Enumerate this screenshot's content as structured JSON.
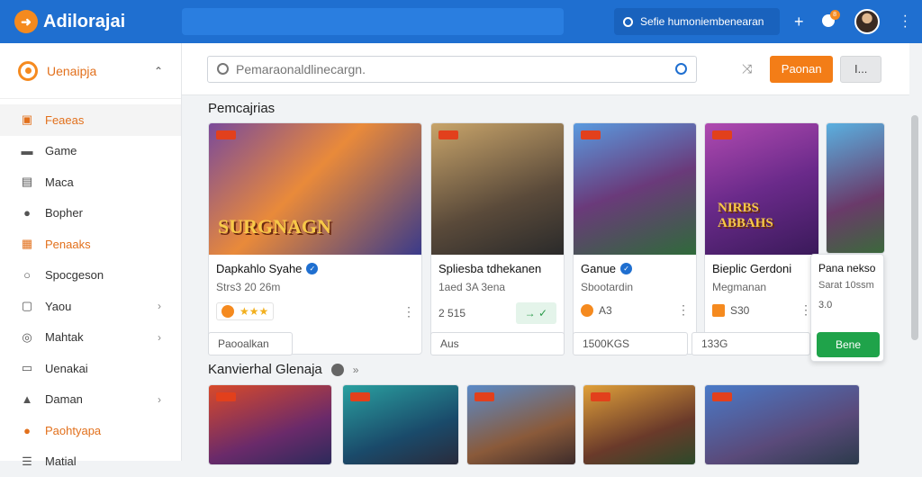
{
  "app": {
    "title": "Adilorajai",
    "top_pill": "Sefie humoniembenearan",
    "notif_count": "8"
  },
  "sidebar": {
    "header": "Uenaipja",
    "items": [
      {
        "label": "Feaeas",
        "icon": "folder-icon",
        "state": "active"
      },
      {
        "label": "Game",
        "icon": "gamepad-icon"
      },
      {
        "label": "Maca",
        "icon": "book-icon"
      },
      {
        "label": "Bopher",
        "icon": "pin-icon"
      },
      {
        "label": "Penaaks",
        "icon": "calendar-icon",
        "state": "orange"
      },
      {
        "label": "Spocgeson",
        "icon": "chat-icon"
      },
      {
        "label": "Yaou",
        "icon": "grid-icon",
        "arrow": true
      },
      {
        "label": "Mahtak",
        "icon": "clock-icon",
        "arrow": true
      },
      {
        "label": "Uenakai",
        "icon": "document-icon"
      },
      {
        "label": "Daman",
        "icon": "image-icon",
        "arrow": true
      },
      {
        "label": "Paohtyapa",
        "icon": "coin-icon",
        "state": "orange"
      },
      {
        "label": "Matial",
        "icon": "list-icon"
      }
    ]
  },
  "search": {
    "placeholder": "Pemaraonaldlinecargn.",
    "primary_button": "Paonan",
    "secondary_button": "I..."
  },
  "section1": {
    "title": "Pemcajrias"
  },
  "cards": [
    {
      "name": "Dapkahlo Syahe",
      "verified": true,
      "sub": "Strs3 20 26m",
      "thumb_text": "SURGNAGN",
      "rating": "★★★"
    },
    {
      "name": "Spliesba tdhekanen",
      "verified": false,
      "sub": "1aed 3A 3ena",
      "meta": "2 515",
      "action": "→ ✓"
    },
    {
      "name": "Ganue",
      "verified": true,
      "sub": "Sbootardin",
      "meta": "A3"
    },
    {
      "name": "Bieplic Gerdoni",
      "verified": false,
      "sub": "Megmanan",
      "thumb_text": "NIRBS ABBAHS",
      "meta": "S30"
    },
    {
      "name": "Pana nekso",
      "verified": false,
      "sub": "Sarat 10ssm",
      "meta": "3.0",
      "button": "Bene"
    }
  ],
  "below_cards": {
    "b1": "Paooalkan",
    "b2": "Aus",
    "b3": "1500KGS",
    "b4": "133G"
  },
  "section2": {
    "title": "Kanvierhal Glenaja",
    "more": "»"
  },
  "colors": {
    "topbar": "#1f6fd0",
    "accent": "#f37d17",
    "green": "#1fa34a"
  }
}
